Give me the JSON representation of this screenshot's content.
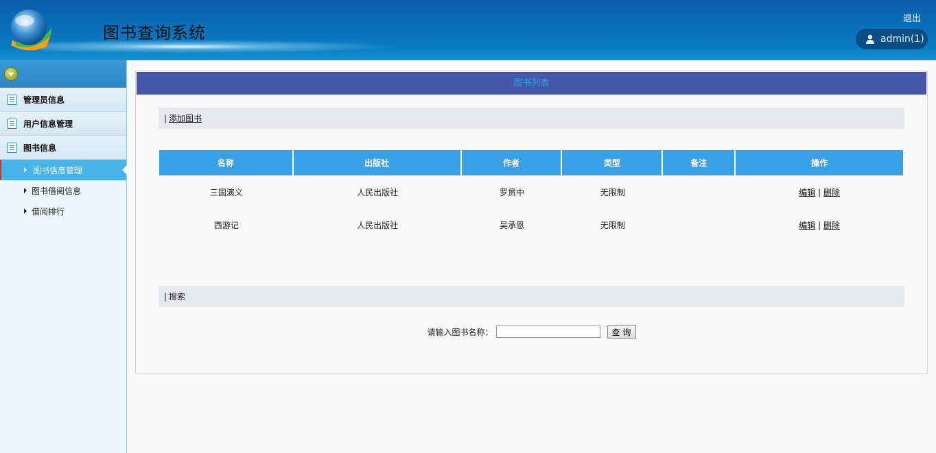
{
  "header": {
    "app_title": "图书查询系统",
    "logout_label": "退出",
    "user_label": "admin(1)"
  },
  "sidebar": {
    "groups": [
      {
        "label": "管理员信息"
      },
      {
        "label": "用户信息管理"
      },
      {
        "label": "图书信息"
      }
    ],
    "sub_items": [
      {
        "label": "图书信息管理",
        "active": true
      },
      {
        "label": "图书借阅信息",
        "active": false
      },
      {
        "label": "借阅排行",
        "active": false
      }
    ]
  },
  "main": {
    "panel_title": "图书列表",
    "add_bar": {
      "separator": "|",
      "link_label": "添加图书"
    },
    "table": {
      "columns": [
        "名称",
        "出版社",
        "作者",
        "类型",
        "备注",
        "操作"
      ],
      "rows": [
        {
          "name": "三国演义",
          "publisher": "人民出版社",
          "author": "罗贯中",
          "type": "无限制",
          "note": "",
          "edit": "编辑",
          "pipe": "|",
          "delete": "删除"
        },
        {
          "name": "西游记",
          "publisher": "人民出版社",
          "author": "吴承恩",
          "type": "无限制",
          "note": "",
          "edit": "编辑",
          "pipe": "|",
          "delete": "删除"
        }
      ]
    },
    "search_bar": {
      "separator": "|",
      "label": "搜索"
    },
    "search": {
      "prompt": "请输入图书名称：",
      "input_value": "",
      "button_label": "查 询"
    }
  },
  "colors": {
    "header_blue": "#0a6fba",
    "panel_head": "#4656ab",
    "panel_title_text": "#1aa9e6",
    "table_head": "#3aa0e6",
    "sidebar_active": "#47b3e6"
  }
}
